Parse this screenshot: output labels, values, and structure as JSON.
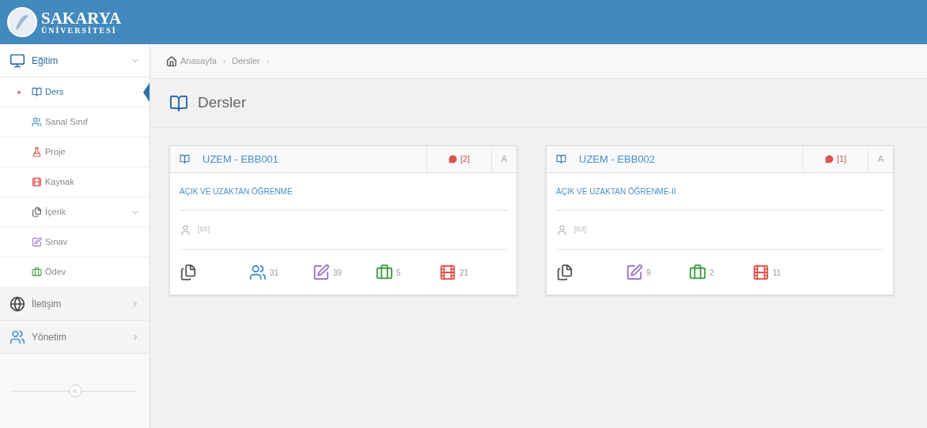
{
  "header": {
    "logo_title": "SAKARYA",
    "logo_subtitle": "ÜNİVERSİTESİ"
  },
  "sidebar": {
    "sections": [
      {
        "label": "Eğitim",
        "kind": "monitor",
        "expanded": true,
        "children": [
          {
            "label": "Ders",
            "kind": "book",
            "selected": true
          },
          {
            "label": "Sanal Sınıf",
            "kind": "users",
            "selected": false
          },
          {
            "label": "Proje",
            "kind": "flask",
            "selected": false
          },
          {
            "label": "Kaynak",
            "kind": "film",
            "selected": false
          },
          {
            "label": "İçerik",
            "kind": "files",
            "selected": false,
            "expandable": true
          },
          {
            "label": "Sınav",
            "kind": "edit",
            "selected": false
          },
          {
            "label": "Ödev",
            "kind": "briefcase",
            "selected": false
          }
        ]
      },
      {
        "label": "İletişim",
        "kind": "globe",
        "expanded": false
      },
      {
        "label": "Yönetim",
        "kind": "users",
        "expanded": false
      }
    ]
  },
  "breadcrumb": [
    {
      "label": "Anasayfa",
      "separator": "›"
    },
    {
      "label": "Dersler",
      "separator": "›"
    }
  ],
  "page_title": "Dersler",
  "courses": [
    {
      "code": "UZEM - EBB001",
      "messages": "[2]",
      "letter": "A",
      "name": "AÇIK VE UZAKTAN ÖĞRENME",
      "students": "[65]",
      "stats": [
        {
          "kind": "files"
        },
        {
          "kind": "users",
          "count": "31"
        },
        {
          "kind": "edit",
          "count": "39"
        },
        {
          "kind": "briefcase",
          "count": "5"
        },
        {
          "kind": "film",
          "count": "21"
        }
      ]
    },
    {
      "code": "UZEM - EBB002",
      "messages": "[1]",
      "letter": "A",
      "name": "AÇIK VE UZAKTAN ÖĞRENME-II",
      "students": "[83]",
      "stats": [
        {
          "kind": "files"
        },
        {
          "kind": "edit",
          "count": "9"
        },
        {
          "kind": "briefcase",
          "count": "2"
        },
        {
          "kind": "film",
          "count": "11"
        }
      ]
    }
  ]
}
